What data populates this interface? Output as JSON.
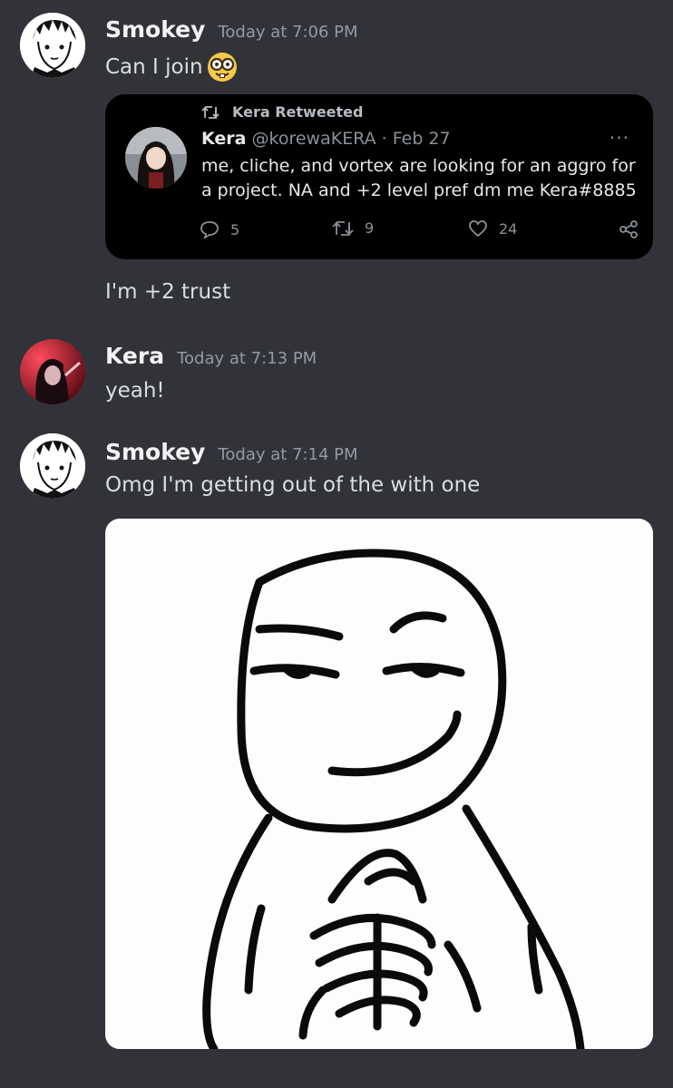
{
  "messages": [
    {
      "author": "Smokey",
      "timestamp": "Today at 7:06 PM",
      "text": "Can I join",
      "emoji": "nerd-face-emoji"
    },
    {
      "author": "",
      "timestamp": "",
      "text": "I'm +2 trust"
    },
    {
      "author": "Kera",
      "timestamp": "Today at 7:13 PM",
      "text": "yeah!"
    },
    {
      "author": "Smokey",
      "timestamp": "Today at 7:14 PM",
      "text": "Omg I'm getting out of the with one"
    }
  ],
  "tweet": {
    "retweet_label": "Kera Retweeted",
    "name": "Kera",
    "handle": "@korewaKERA · Feb 27",
    "more": "···",
    "body": "me, cliche, and vortex are looking for an aggro for a project. NA and +2 level pref dm me Kera#8885",
    "replies": "5",
    "retweets": "9",
    "likes": "24"
  },
  "colors": {
    "background": "#313338",
    "author_text": "#f2f3f5",
    "message_text": "#dbdee1",
    "timestamp_text": "#949ba4",
    "tweet_background": "#000000"
  }
}
